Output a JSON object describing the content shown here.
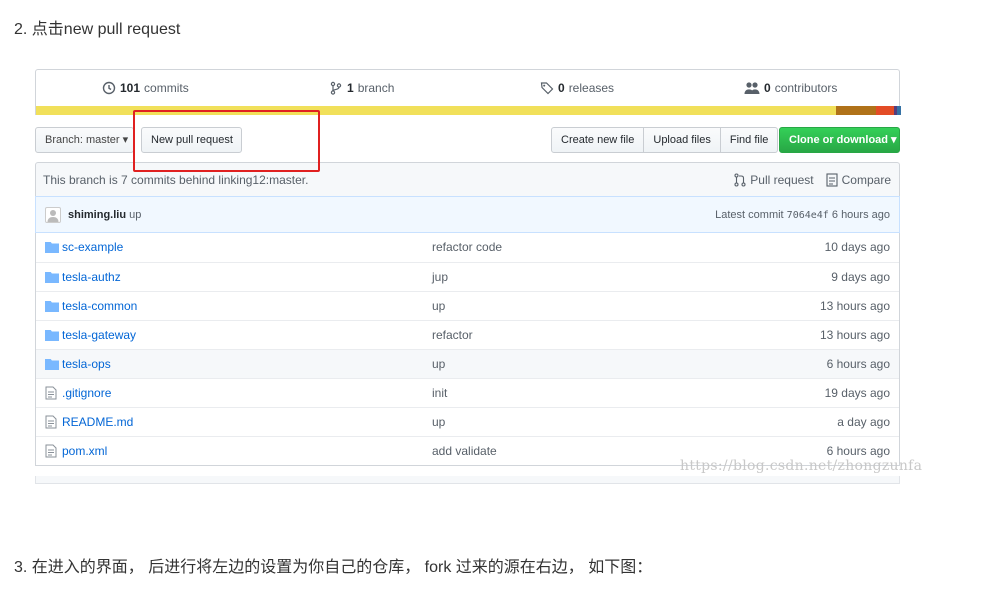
{
  "steps": {
    "step2": "2. 点击new pull request",
    "step3": "3. 在进入的界面， 后进行将左边的设置为你自己的仓库， fork 过来的源在右边， 如下图："
  },
  "summary": {
    "commits_count": "101",
    "commits_label": "commits",
    "branch_count": "1",
    "branch_label": "branch",
    "releases_count": "0",
    "releases_label": "releases",
    "contributors_count": "0",
    "contributors_label": "contributors"
  },
  "lang_colors": [
    "#f1e05a",
    "#b07219",
    "#e34c26",
    "#563d7c",
    "#3572A5"
  ],
  "toolbar": {
    "branch_label": "Branch: master ▾",
    "new_pr": "New pull request",
    "create_file": "Create new file",
    "upload_files": "Upload files",
    "find_file": "Find file",
    "clone": "Clone or download ▾"
  },
  "behind": {
    "text": "This branch is 7 commits behind linking12:master.",
    "pull_request": "Pull request",
    "compare": "Compare"
  },
  "commit": {
    "author": "shiming.liu",
    "message": "up",
    "latest_label": "Latest commit",
    "sha": "7064e4f",
    "age": "6 hours ago"
  },
  "files": [
    {
      "type": "dir",
      "name": "sc-example",
      "msg": "refactor code",
      "age": "10 days ago"
    },
    {
      "type": "dir",
      "name": "tesla-authz",
      "msg": "jup",
      "age": "9 days ago"
    },
    {
      "type": "dir",
      "name": "tesla-common",
      "msg": "up",
      "age": "13 hours ago"
    },
    {
      "type": "dir",
      "name": "tesla-gateway",
      "msg": "refactor",
      "age": "13 hours ago"
    },
    {
      "type": "dir",
      "name": "tesla-ops",
      "msg": "up",
      "age": "6 hours ago"
    },
    {
      "type": "file",
      "name": ".gitignore",
      "msg": "init",
      "age": "19 days ago"
    },
    {
      "type": "file",
      "name": "README.md",
      "msg": "up",
      "age": "a day ago"
    },
    {
      "type": "file",
      "name": "pom.xml",
      "msg": "add validate",
      "age": "6 hours ago"
    }
  ],
  "watermark": "https://blog.csdn.net/zhongzunfa"
}
